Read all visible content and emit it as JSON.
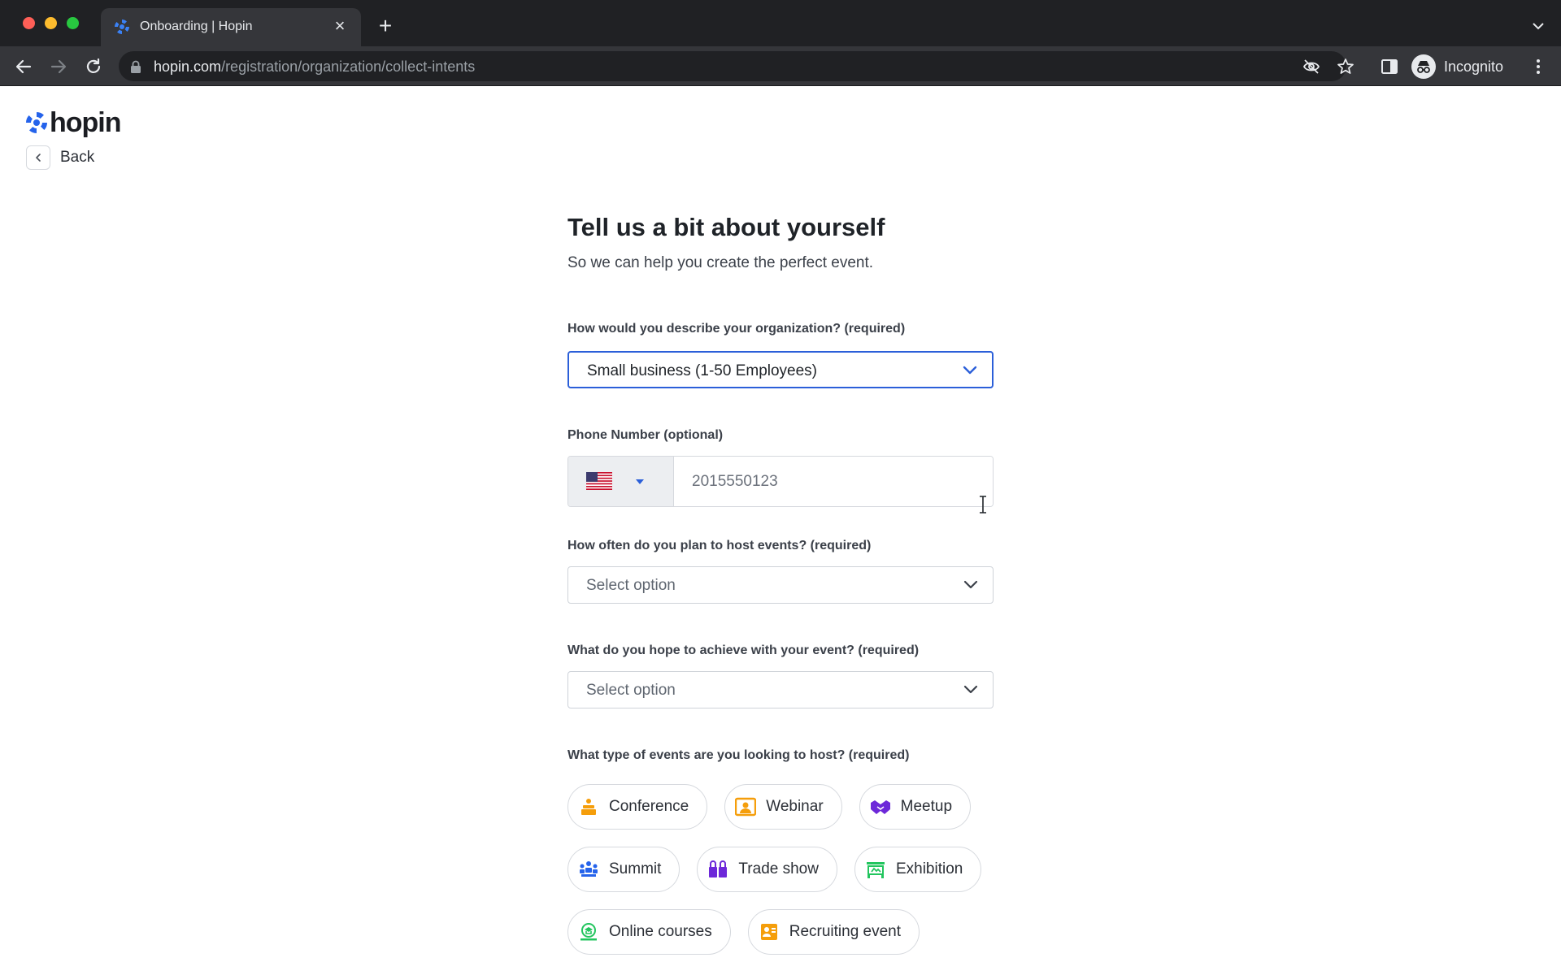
{
  "browser": {
    "tab_title": "Onboarding | Hopin",
    "url_host": "hopin.com",
    "url_path": "/registration/organization/collect-intents",
    "profile_label": "Incognito"
  },
  "page": {
    "logo_text": "hopin",
    "back_label": "Back",
    "heading": "Tell us a bit about yourself",
    "subheading": "So we can help you create the perfect event.",
    "org_label": "How would you describe your organization? (required)",
    "org_value": "Small business (1-50 Employees)",
    "phone_label": "Phone Number (optional)",
    "phone_placeholder": "2015550123",
    "frequency_label": "How often do you plan to host events? (required)",
    "frequency_placeholder": "Select option",
    "goal_label": "What do you hope to achieve with your event? (required)",
    "goal_placeholder": "Select option",
    "event_types_label": "What type of events are you looking to host? (required)",
    "event_types": [
      {
        "label": "Conference",
        "icon": "conference-icon",
        "color": "#f59e0b"
      },
      {
        "label": "Webinar",
        "icon": "webinar-icon",
        "color": "#f59e0b"
      },
      {
        "label": "Meetup",
        "icon": "meetup-icon",
        "color": "#6d28d9"
      },
      {
        "label": "Summit",
        "icon": "summit-icon",
        "color": "#2563eb"
      },
      {
        "label": "Trade show",
        "icon": "trade-show-icon",
        "color": "#6d28d9"
      },
      {
        "label": "Exhibition",
        "icon": "exhibition-icon",
        "color": "#22c55e"
      },
      {
        "label": "Online courses",
        "icon": "online-courses-icon",
        "color": "#22c55e"
      },
      {
        "label": "Recruiting event",
        "icon": "recruiting-event-icon",
        "color": "#f59e0b"
      }
    ]
  },
  "colors": {
    "accent": "#2b5fd9",
    "brand": "#2563eb"
  }
}
